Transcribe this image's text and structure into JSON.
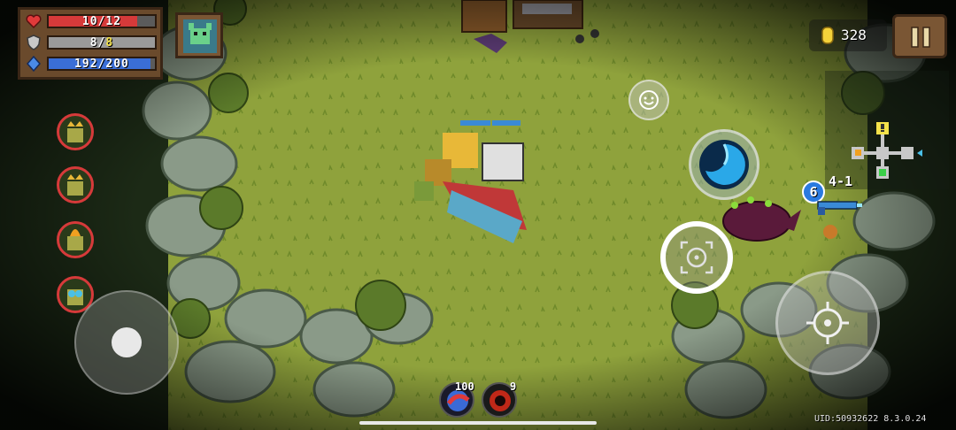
{
  "hud": {
    "hp": {
      "current": 10,
      "max": 12,
      "text": "10/12",
      "color": "#d63a3a"
    },
    "armor": {
      "current": 8,
      "max": 8,
      "value": "8",
      "max_text": "8",
      "color": "#9a9a9a"
    },
    "energy": {
      "current": 192,
      "max": 200,
      "text": "192/200",
      "color": "#3a6ed6"
    }
  },
  "currency": {
    "gold": "328",
    "icon": "gold-coin-icon"
  },
  "level": {
    "stage": "4-1"
  },
  "weapon": {
    "energy_cost": "6",
    "icon": "blue-rifle-icon"
  },
  "skills": [
    {
      "name": "red-blue-orb-skill-icon",
      "count": "100"
    },
    {
      "name": "dark-vortex-skill-icon",
      "count": "9"
    }
  ],
  "buffs": [
    "crown-goblin-buff-icon",
    "crown-goblin-buff-icon",
    "flame-goblin-buff-icon",
    "goggles-goblin-buff-icon"
  ],
  "footer": {
    "uid": "UID:50932622 8.3.0.24"
  },
  "colors": {
    "grass": "#8fa23c",
    "rock": "#8a9a88",
    "tree": "#5b7a2a"
  }
}
